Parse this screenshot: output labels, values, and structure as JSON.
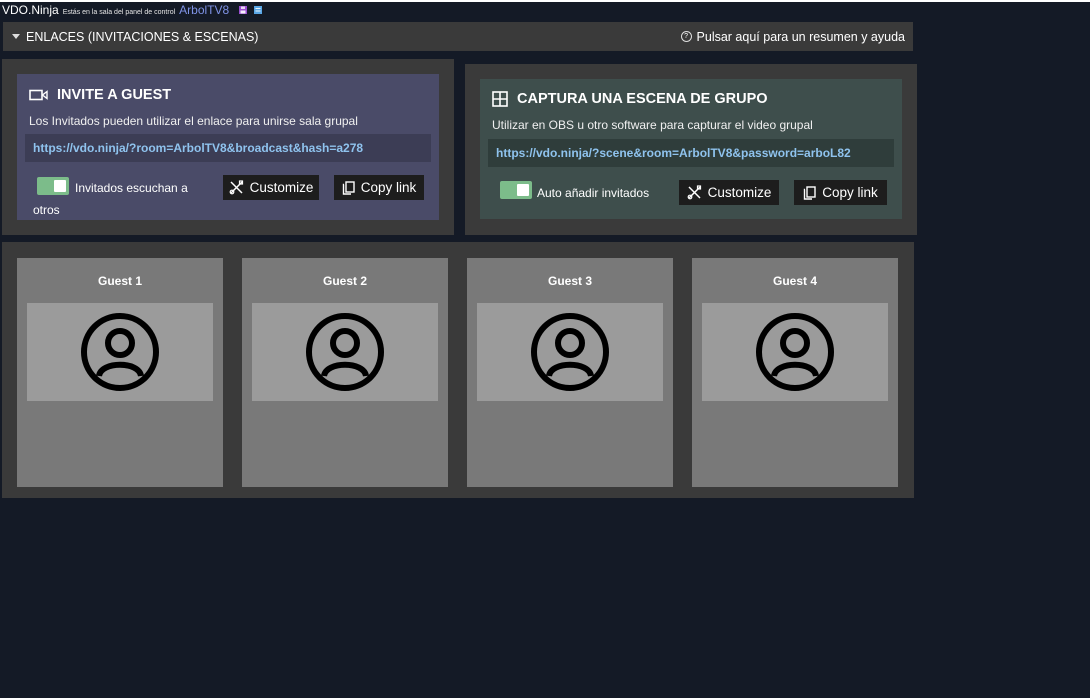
{
  "header": {
    "brand": "VDO.Ninja",
    "room_text": "Estás en la sala del panel de control",
    "room_name": "ArbolTV8"
  },
  "links_bar": {
    "title": "ENLACES (INVITACIONES & ESCENAS)",
    "help": "Pulsar aquí para un resumen y ayuda"
  },
  "invite": {
    "title": "INVITE A GUEST",
    "description": "Los Invitados pueden utilizar el enlace para unirse sala grupal",
    "link": "https://vdo.ninja/?room=ArbolTV8&broadcast&hash=a278",
    "toggle_label_1": "Invitados escuchan a",
    "toggle_label_2": "otros",
    "customize_label": "Customize",
    "copy_label": "Copy link",
    "bg_color": "#4a4b68"
  },
  "scene": {
    "title": "CAPTURA UNA ESCENA DE GRUPO",
    "description": "Utilizar en OBS u otro software para capturar el video grupal",
    "link": "https://vdo.ninja/?scene&room=ArbolTV8&password=arboL82",
    "toggle_label": "Auto añadir invitados",
    "customize_label": "Customize",
    "copy_label": "Copy link",
    "bg_color": "#3e4e4c"
  },
  "guests": [
    {
      "label": "Guest 1"
    },
    {
      "label": "Guest 2"
    },
    {
      "label": "Guest 3"
    },
    {
      "label": "Guest 4"
    }
  ],
  "icons": {
    "help": "help-circle-icon",
    "camera": "video-camera-icon",
    "grid": "grid-icon",
    "tools": "tools-icon",
    "copy": "copy-icon",
    "avatar": "user-avatar-icon"
  }
}
